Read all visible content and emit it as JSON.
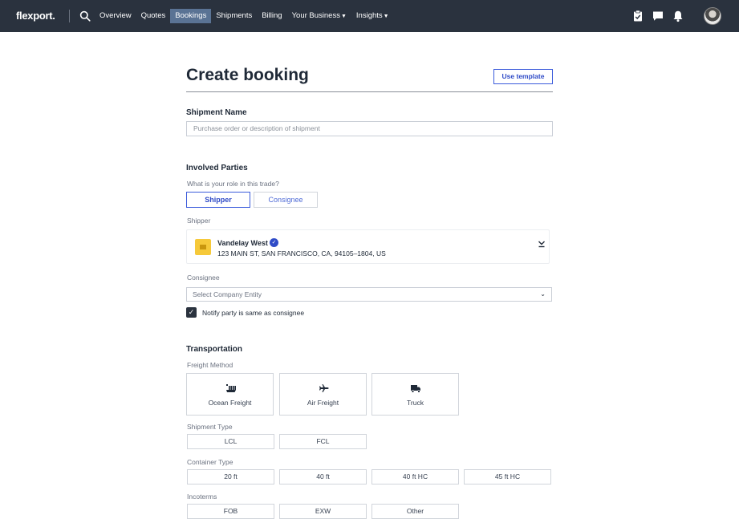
{
  "nav": {
    "logo": "flexport.",
    "items": [
      {
        "label": "Overview"
      },
      {
        "label": "Quotes"
      },
      {
        "label": "Bookings",
        "active": true
      },
      {
        "label": "Shipments"
      },
      {
        "label": "Billing"
      },
      {
        "label": "Your Business",
        "dropdown": true
      },
      {
        "label": "Insights",
        "dropdown": true
      }
    ],
    "right_icons": [
      "clipboard-check-icon",
      "chat-icon",
      "bell-icon"
    ],
    "active_color": "#5a7394",
    "bar_color": "#2a323e"
  },
  "form": {
    "title": "Create booking",
    "template_button": "Use template",
    "shipment_name": {
      "heading": "Shipment Name",
      "placeholder": "Purchase order or description of shipment"
    },
    "parties": {
      "heading": "Involved Parties",
      "role_question": "What is your role in this trade?",
      "roles": [
        {
          "label": "Shipper",
          "selected": true
        },
        {
          "label": "Consignee",
          "selected": false
        }
      ],
      "shipper_label": "Shipper",
      "shipper": {
        "name": "Vandelay West",
        "address": "123 MAIN ST, SAN FRANCISCO, CA, 94105–1804, US",
        "verified": true
      },
      "consignee_label": "Consignee",
      "consignee_placeholder": "Select Company Entity",
      "notify_checked": true,
      "notify_label": "Notify party is same as consignee"
    },
    "transportation": {
      "heading": "Transportation",
      "freight_label": "Freight Method",
      "freight_methods": [
        {
          "label": "Ocean Freight",
          "icon": "ship-icon"
        },
        {
          "label": "Air Freight",
          "icon": "airplane-icon"
        },
        {
          "label": "Truck",
          "icon": "truck-icon"
        }
      ],
      "shipment_type_label": "Shipment Type",
      "shipment_types": [
        "LCL",
        "FCL"
      ],
      "container_type_label": "Container Type",
      "container_types": [
        "20 ft",
        "40 ft",
        "40 ft HC",
        "45 ft HC"
      ],
      "incoterms_label": "Incoterms",
      "incoterms": [
        "FOB",
        "EXW",
        "Other"
      ]
    }
  },
  "accent_color": "#3b5bdb"
}
